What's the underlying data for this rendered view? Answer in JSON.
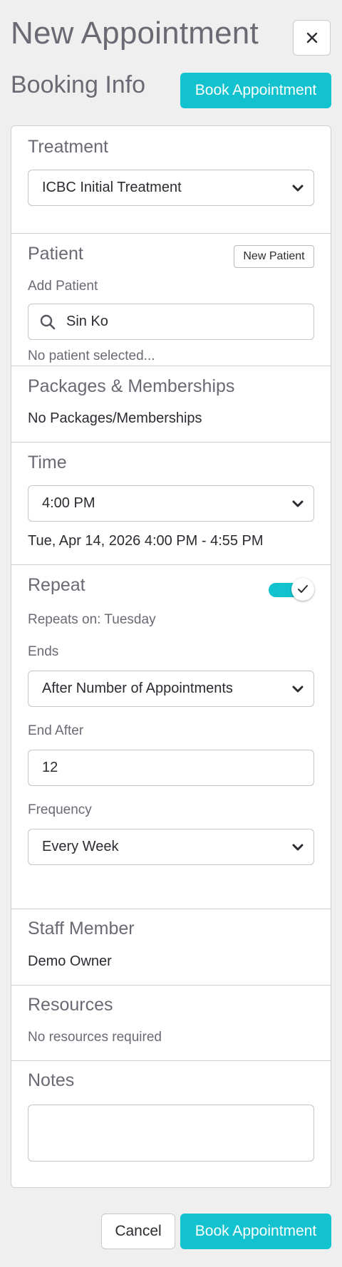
{
  "header": {
    "title": "New Appointment",
    "close_icon": "close-icon",
    "subtitle": "Booking Info",
    "book_button": "Book Appointment"
  },
  "treatment": {
    "title": "Treatment",
    "selected": "ICBC Initial Treatment"
  },
  "patient": {
    "title": "Patient",
    "new_patient_button": "New Patient",
    "add_label": "Add Patient",
    "search_value": "Sin Ko",
    "status": "No patient selected..."
  },
  "packages": {
    "title": "Packages & Memberships",
    "value": "No Packages/Memberships"
  },
  "time": {
    "title": "Time",
    "selected": "4:00 PM",
    "summary": "Tue, Apr 14, 2026 4:00 PM - 4:55 PM"
  },
  "repeat": {
    "title": "Repeat",
    "enabled": true,
    "repeats_on": "Repeats on: Tuesday",
    "ends_label": "Ends",
    "ends_selected": "After Number of Appointments",
    "end_after_label": "End After",
    "end_after_value": "12",
    "frequency_label": "Frequency",
    "frequency_selected": "Every Week"
  },
  "staff": {
    "title": "Staff Member",
    "value": "Demo Owner"
  },
  "resources": {
    "title": "Resources",
    "value": "No resources required"
  },
  "notes": {
    "title": "Notes",
    "value": ""
  },
  "footer": {
    "cancel_button": "Cancel",
    "book_button": "Book Appointment"
  },
  "colors": {
    "accent": "#12c2cf",
    "background": "#efeff0",
    "muted_text": "#6b6a74"
  }
}
